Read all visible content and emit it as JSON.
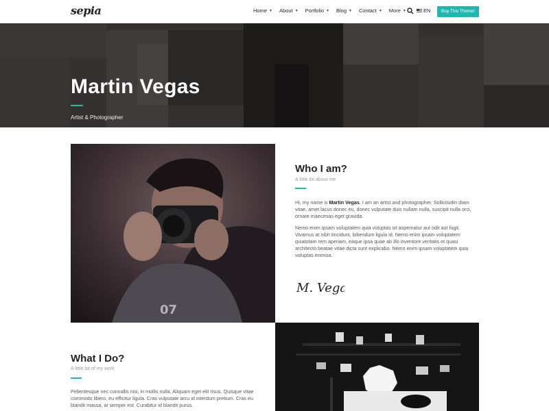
{
  "header": {
    "logo": "sepia",
    "nav": [
      {
        "label": "Home"
      },
      {
        "label": "About"
      },
      {
        "label": "Portfolio"
      },
      {
        "label": "Blog"
      },
      {
        "label": "Contact"
      },
      {
        "label": "More"
      }
    ],
    "lang": "EN",
    "buy_label": "Buy This Theme!"
  },
  "hero": {
    "title": "Martin Vegas",
    "subtitle": "Artist & Photographer"
  },
  "about": {
    "title": "Who I am?",
    "subtitle": "A little bit about me",
    "p1_pre": "Hi, my name is ",
    "p1_name": "Martin Vegas",
    "p1_post": ". I am an artist and photographer. Sollicitudin diam vitae, amet lacus donec eu, donec vulputate duis nullam nulla, suscipit nulla orci, ornare maecenas eget gravida.",
    "p2": "Nemo enim ipsam voluptatem quia voluptas sit aspernatur aut odit aut fugit. Vivamus at nibh tincidunt, bibendum ligula id. Nemo enim ipsam voluptatem quiatotam rem aperiam, eaque ipsa quae ab illo inventore veritatis et quasi architecto beatae vitae dicta sunt explicabo. Nemo enim ipsam voluptatem quia voluptas enimoa.",
    "signature": "M. Vegas"
  },
  "services": {
    "title": "What I Do?",
    "subtitle": "A little bit of my work",
    "p1": "Pellentesque nec convallis nisi, in mollis nulla. Aliquam eget elit risus. Quisque vitae commodo libero, eu efficitur ligula. Cras vulputate arcu id interdum pretium. Cras eu blandit massa, at semper est. Curabitur id blandit purus."
  },
  "colors": {
    "accent": "#1fb8b0",
    "hero_bg": "#3b3937"
  }
}
